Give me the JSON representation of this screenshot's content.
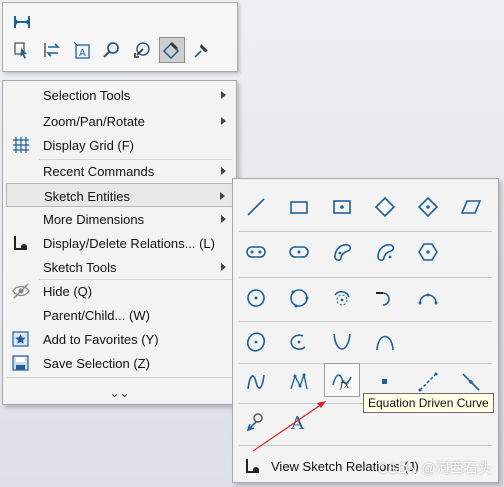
{
  "toolbar": {
    "buttons": [
      "smart-dimension-icon",
      "select-other-icon",
      "reverse-icon",
      "note-icon",
      "zoom-icon",
      "rotate-icon",
      "sketch-icon",
      "rapid-sketch-icon"
    ]
  },
  "context_menu": {
    "items": [
      {
        "label": "Selection Tools",
        "submenu": true
      },
      {
        "label": "Zoom/Pan/Rotate",
        "submenu": true
      },
      {
        "label": "Display Grid (F)",
        "submenu": false
      },
      {
        "label": "Recent Commands",
        "submenu": true
      },
      {
        "label": "Sketch Entities",
        "submenu": true,
        "highlighted": true
      },
      {
        "label": "More Dimensions",
        "submenu": true
      },
      {
        "label": "Display/Delete Relations... (L)",
        "submenu": false
      },
      {
        "label": "Sketch Tools",
        "submenu": true
      },
      {
        "label": "Hide (Q)",
        "submenu": false
      },
      {
        "label": "Parent/Child... (W)",
        "submenu": false
      },
      {
        "label": "Add to Favorites (Y)",
        "submenu": false
      },
      {
        "label": "Save Selection (Z)",
        "submenu": false
      }
    ],
    "more_glyph": "⌄⌄"
  },
  "flyout": {
    "view_relations_label": "View Sketch Relations (J)",
    "tooltip": "Equation Driven Curve"
  },
  "watermark": "CSDN @河西石头",
  "colors": {
    "icon_blue": "#1f5f9a",
    "annotation_red": "#e02020"
  }
}
